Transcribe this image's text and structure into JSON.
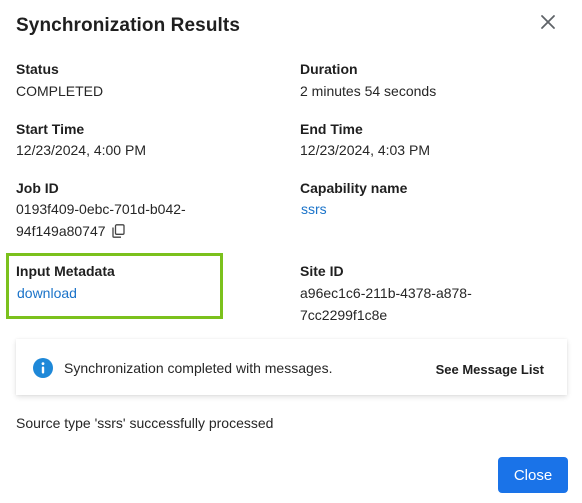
{
  "dialog": {
    "title": "Synchronization Results",
    "close_icon": "close-icon"
  },
  "fields": {
    "status": {
      "label": "Status",
      "value": "COMPLETED"
    },
    "duration": {
      "label": "Duration",
      "value": "2 minutes 54 seconds"
    },
    "start_time": {
      "label": "Start Time",
      "value": "12/23/2024, 4:00 PM"
    },
    "end_time": {
      "label": "End Time",
      "value": "12/23/2024, 4:03 PM"
    },
    "job_id": {
      "label": "Job ID",
      "value_line1": "0193f409-0ebc-701d-b042-",
      "value_line2": "94f149a80747",
      "copy_icon": "copy-icon"
    },
    "capability": {
      "label": "Capability name",
      "value": "ssrs"
    },
    "input_metadata": {
      "label": "Input Metadata",
      "value": "download"
    },
    "site_id": {
      "label": "Site ID",
      "value_line1": "a96ec1c6-211b-4378-a878-",
      "value_line2": "7cc2299f1c8e"
    }
  },
  "message_bar": {
    "icon": "info-icon",
    "text": "Synchronization completed with messages.",
    "link_label": "See Message List"
  },
  "source_message": "Source type 'ssrs' successfully processed",
  "footer": {
    "close_label": "Close"
  },
  "colors": {
    "accent": "#1a73e8",
    "link": "#1a73c9",
    "highlight": "#7bc11c"
  }
}
